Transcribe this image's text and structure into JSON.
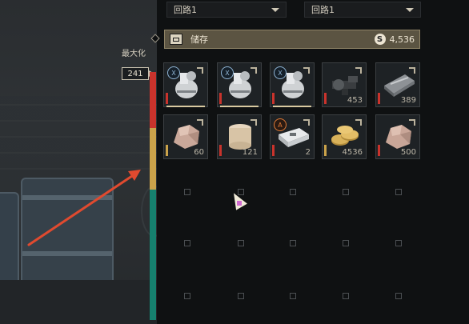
{
  "dropdowns": [
    {
      "value": "回路1"
    },
    {
      "value": "回路1"
    }
  ],
  "storage": {
    "label": "储存",
    "currency_icon": "S",
    "amount": "4,536"
  },
  "capacity": {
    "max_label": "最大化",
    "count": "241",
    "bands": [
      "#c9332c",
      "#caa24a",
      "#16806e"
    ]
  },
  "grid": {
    "rows": [
      [
        {
          "item": "item-1",
          "qty": "",
          "tier_color": "#c9332c",
          "badge": "X",
          "badge_color": "blue"
        },
        {
          "item": "item-2",
          "qty": "",
          "tier_color": "#c9332c",
          "badge": "X",
          "badge_color": "blue"
        },
        {
          "item": "item-3",
          "qty": "",
          "tier_color": "#c9332c",
          "badge": "X",
          "badge_color": "blue"
        },
        {
          "item": "item-4",
          "qty": "453",
          "tier_color": "#c9332c",
          "badge": "",
          "badge_color": ""
        },
        {
          "item": "item-5",
          "qty": "389",
          "tier_color": "#c9332c",
          "badge": "",
          "badge_color": ""
        }
      ],
      [
        {
          "item": "item-6",
          "qty": "60",
          "tier_color": "#caa24a",
          "badge": "",
          "badge_color": ""
        },
        {
          "item": "item-7",
          "qty": "121",
          "tier_color": "#c9332c",
          "badge": "",
          "badge_color": ""
        },
        {
          "item": "item-8",
          "qty": "2",
          "tier_color": "#c9332c",
          "badge": "A",
          "badge_color": "orange"
        },
        {
          "item": "item-9",
          "qty": "4536",
          "tier_color": "#caa24a",
          "badge": "",
          "badge_color": ""
        },
        {
          "item": "item-10",
          "qty": "500",
          "tier_color": "#c9332c",
          "badge": "",
          "badge_color": ""
        }
      ]
    ]
  },
  "colors": {
    "accent": "#caa24a",
    "panel": "#0f1112",
    "storage_bar": "#5b5442",
    "annotation_arrow": "#e04a2f"
  }
}
